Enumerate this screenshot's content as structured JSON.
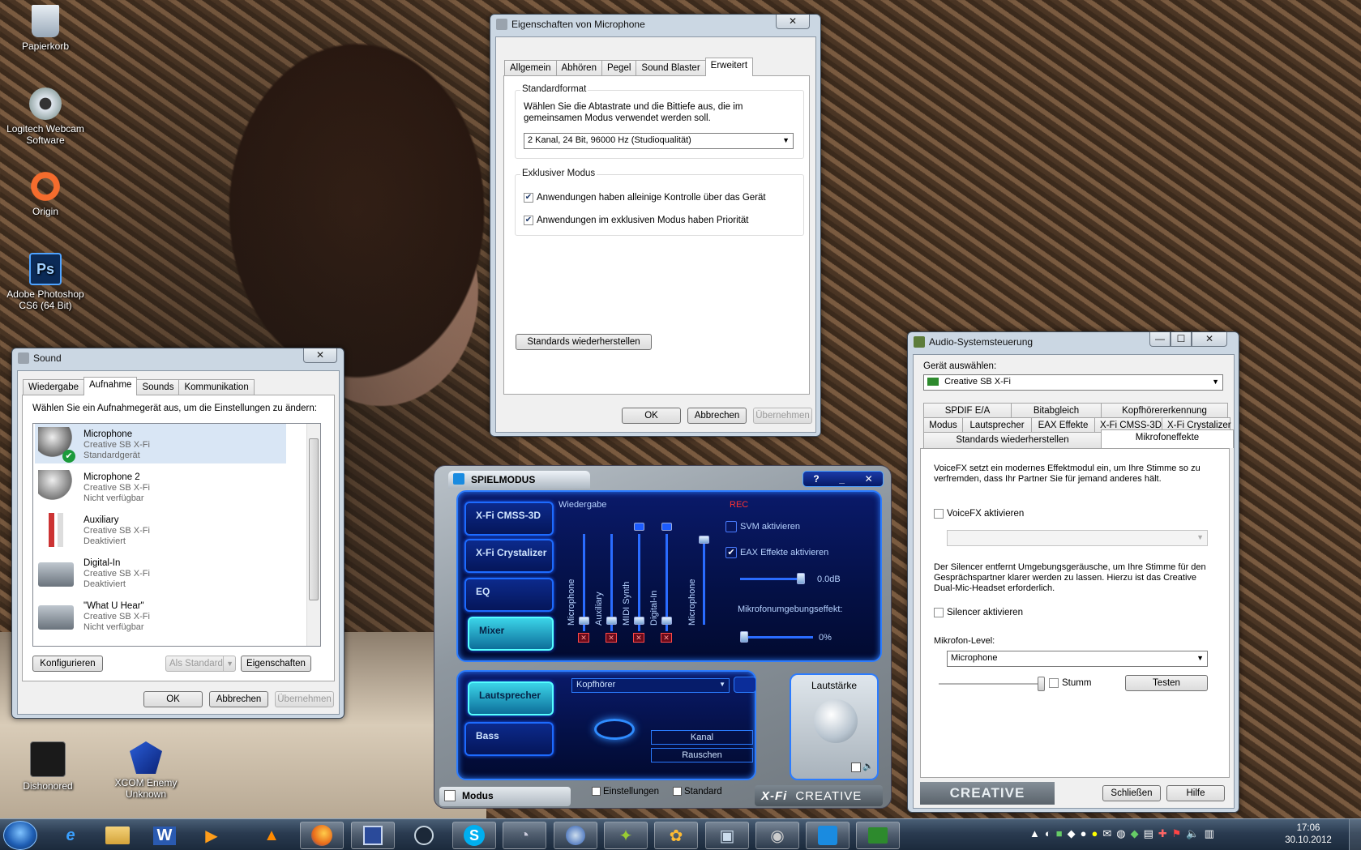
{
  "desktop": {
    "icons": [
      {
        "label": "Papierkorb"
      },
      {
        "label": "Logitech Webcam Software"
      },
      {
        "label": "Origin"
      },
      {
        "label": "Adobe Photoshop CS6 (64 Bit)"
      },
      {
        "label": "Dishonored"
      },
      {
        "label": "XCOM Enemy Unknown"
      }
    ]
  },
  "mic_props": {
    "title": "Eigenschaften von Microphone",
    "close": "✕",
    "tabs": [
      "Allgemein",
      "Abhören",
      "Pegel",
      "Sound Blaster",
      "Erweitert"
    ],
    "std_format_title": "Standardformat",
    "std_format_desc": "Wählen Sie die Abtastrate und die Bittiefe aus, die im gemeinsamen Modus verwendet werden soll.",
    "format_value": "2 Kanal, 24 Bit, 96000 Hz (Studioqualität)",
    "exclusive_title": "Exklusiver Modus",
    "excl_1": "Anwendungen haben alleinige Kontrolle über das Gerät",
    "excl_2": "Anwendungen im exklusiven Modus haben Priorität",
    "restore": "Standards wiederherstellen",
    "ok": "OK",
    "cancel": "Abbrechen",
    "apply": "Übernehmen"
  },
  "sound": {
    "title": "Sound",
    "close": "✕",
    "tabs": [
      "Wiedergabe",
      "Aufnahme",
      "Sounds",
      "Kommunikation"
    ],
    "instruction": "Wählen Sie ein Aufnahmegerät aus, um die Einstellungen zu ändern:",
    "devices": [
      {
        "name": "Microphone",
        "sub": "Creative SB X-Fi",
        "status": "Standardgerät"
      },
      {
        "name": "Microphone 2",
        "sub": "Creative SB X-Fi",
        "status": "Nicht verfügbar"
      },
      {
        "name": "Auxiliary",
        "sub": "Creative SB X-Fi",
        "status": "Deaktiviert"
      },
      {
        "name": "Digital-In",
        "sub": "Creative SB X-Fi",
        "status": "Deaktiviert"
      },
      {
        "name": "\"What U Hear\"",
        "sub": "Creative SB X-Fi",
        "status": "Nicht verfügbar"
      }
    ],
    "configure": "Konfigurieren",
    "set_default": "Als Standard",
    "properties": "Eigenschaften",
    "ok": "OK",
    "cancel": "Abbrechen",
    "apply": "Übernehmen"
  },
  "console": {
    "title": "SPIELMODUS",
    "help": "?",
    "min": "_",
    "close": "✕",
    "modes": [
      "X-Fi CMSS-3D",
      "X-Fi Crystalizer",
      "EQ",
      "Mixer"
    ],
    "playback_label": "Wiedergabe",
    "rec_label": "REC",
    "channels": [
      "Microphone",
      "Auxiliary",
      "MIDI Synth",
      "Digital-In"
    ],
    "rec_channel": "Microphone",
    "svm": "SVM aktivieren",
    "eax": "EAX Effekte aktivieren",
    "eax_db": "0.0dB",
    "ambient_label": "Mikrofonumgebungseffekt:",
    "ambient_value": "0%",
    "speaker_btn": "Lautsprecher",
    "bass_btn": "Bass",
    "headphone_select": "Kopfhörer",
    "channel_btn": "Kanal",
    "noise_btn": "Rauschen",
    "volume_label": "Lautstärke",
    "mode_label": "Modus",
    "settings": "Einstellungen",
    "standard": "Standard",
    "xfi_logo": "X-Fi",
    "creative_logo": "CREATIVE"
  },
  "audio_ctrl": {
    "title": "Audio-Systemsteuerung",
    "min": "—",
    "max": "☐",
    "close": "✕",
    "select_device_label": "Gerät auswählen:",
    "device": "Creative SB X-Fi",
    "tabs_row1": [
      "SPDIF E/A",
      "Bitabgleich",
      "Kopfhörererkennung"
    ],
    "tabs_row2": [
      "Modus",
      "Lautsprecher",
      "EAX Effekte",
      "X-Fi CMSS-3D",
      "X-Fi Crystalizer"
    ],
    "tabs_row3": [
      "Standards wiederherstellen",
      "Mikrofoneffekte"
    ],
    "voicefx_desc": "VoiceFX setzt ein modernes Effektmodul ein, um Ihre Stimme so zu verfremden, dass Ihr Partner Sie für jemand anderes hält.",
    "voicefx_enable": "VoiceFX aktivieren",
    "silencer_desc": "Der Silencer entfernt Umgebungsgeräusche, um Ihre Stimme für den Gesprächspartner klarer werden zu lassen. Hierzu ist das Creative Dual-Mic-Headset erforderlich.",
    "silencer_enable": "Silencer aktivieren",
    "mic_level_label": "Mikrofon-Level:",
    "mic_level_value": "Microphone",
    "mute": "Stumm",
    "test": "Testen",
    "logo": "CREATIVE",
    "close_btn": "Schließen",
    "help_btn": "Hilfe"
  },
  "taskbar": {
    "time": "17:06",
    "date": "30.10.2012"
  },
  "colors": {
    "accent": "#2c7cff",
    "window_frame": "#cbd7e3"
  }
}
